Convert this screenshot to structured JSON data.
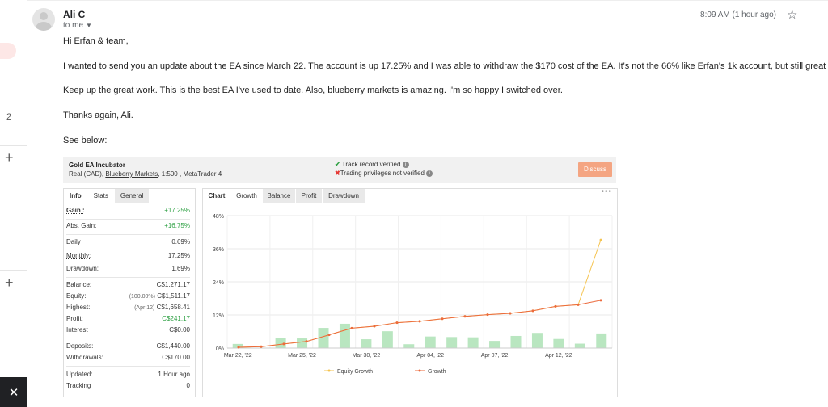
{
  "left_rail": {
    "count": "2",
    "plus": "+",
    "close": "✕"
  },
  "email": {
    "sender": "Ali C",
    "to": "to me",
    "time": "8:09 AM (1 hour ago)",
    "greeting": "Hi Erfan & team,",
    "p1": "I wanted to send you an update about the EA since March 22. The account is up 17.25% and I was able to withdraw the $170 cost of the EA. It's not the 66% like Erfan's 1k account, but still great profits.",
    "p2": "Keep up the great work. This is the best EA I've used to date. Also, blueberry markets is amazing. I'm so happy I switched over.",
    "p3": "Thanks again, Ali.",
    "p4": "See below:"
  },
  "widget": {
    "title": "Gold EA Incubator",
    "sub_prefix": "Real (CAD),",
    "broker": "Blueberry Markets",
    "sub_suffix": ", 1:500 , MetaTrader 4",
    "track": "Track record verified",
    "trading": "Trading privileges not verified",
    "discuss": "Discuss",
    "left_tabs": {
      "info": "Info",
      "stats": "Stats",
      "general": "General"
    },
    "stats": {
      "gain_k": "Gain :",
      "gain_v": "+17.25%",
      "abs_k": "Abs. Gain:",
      "abs_v": "+16.75%",
      "daily_k": "Daily",
      "daily_v": "0.69%",
      "monthly_k": "Monthly:",
      "monthly_v": "17.25%",
      "dd_k": "Drawdown:",
      "dd_v": "1.69%",
      "bal_k": "Balance:",
      "bal_v": "C$1,271.17",
      "eq_k": "Equity:",
      "eq_pct": "(100.00%)",
      "eq_v": "C$1,511.17",
      "hi_k": "Highest:",
      "hi_date": "(Apr 12)",
      "hi_v": "C$1,658.41",
      "pr_k": "Profit:",
      "pr_v": "C$241.17",
      "int_k": "Interest",
      "int_v": "C$0.00",
      "dep_k": "Deposits:",
      "dep_v": "C$1,440.00",
      "wd_k": "Withdrawals:",
      "wd_v": "C$170.00",
      "up_k": "Updated:",
      "up_v": "1 Hour ago",
      "tr_k": "Tracking",
      "tr_v": "0"
    },
    "right_tabs": {
      "chart": "Chart",
      "growth": "Growth",
      "balance": "Balance",
      "profit": "Profit",
      "drawdown": "Drawdown"
    },
    "more": "•••"
  },
  "chart_data": {
    "type": "line",
    "y_ticks": [
      "0%",
      "12%",
      "24%",
      "36%",
      "48%"
    ],
    "ylim": [
      0,
      48
    ],
    "x_tick_labels": [
      "Mar 22, '22",
      "Mar 25, '22",
      "Mar 30, '22",
      "Apr 04, '22",
      "Apr 07, '22",
      "Apr 12, '22"
    ],
    "grid": true,
    "legend_position": "bottom",
    "series": [
      {
        "name": "Equity Growth",
        "color": "#f5c451",
        "values": [
          0.3,
          0.5,
          1.5,
          2.4,
          4.8,
          7.2,
          7.9,
          9.2,
          9.7,
          10.6,
          11.5,
          12.1,
          12.6,
          13.5,
          15.1,
          15.7,
          39.2
        ]
      },
      {
        "name": "Growth",
        "color": "#ec6b3e",
        "values": [
          0.3,
          0.5,
          1.5,
          2.4,
          4.8,
          7.2,
          7.9,
          9.2,
          9.7,
          10.6,
          11.5,
          12.1,
          12.6,
          13.5,
          15.1,
          15.7,
          17.3
        ]
      }
    ],
    "bars": {
      "color": "#b9e6c0",
      "values": [
        1.5,
        0,
        3.6,
        3.5,
        7.3,
        8.8,
        3.2,
        6.1,
        1.4,
        4.2,
        4.0,
        3.9,
        2.6,
        4.4,
        5.5,
        3.3,
        1.6,
        5.3
      ]
    }
  }
}
